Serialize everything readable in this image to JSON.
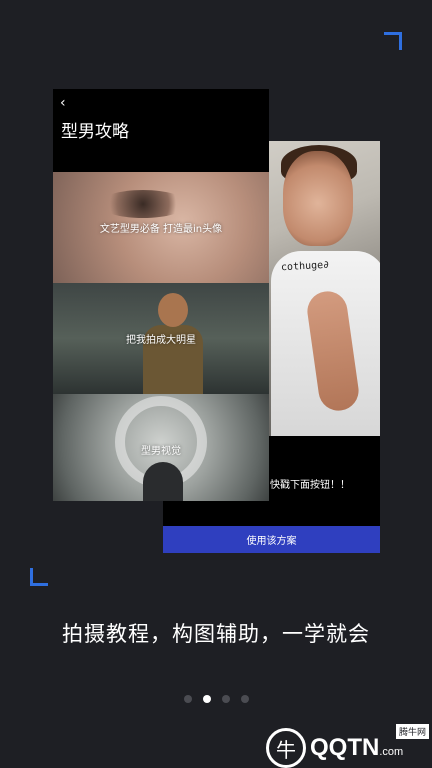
{
  "front_card": {
    "back_glyph": "‹",
    "title": "型男攻略",
    "panels": [
      {
        "label": "文艺型男必备 打造最in头像"
      },
      {
        "label": "把我拍成大明星"
      },
      {
        "label": "型男视觉"
      }
    ]
  },
  "back_card": {
    "shirt_print": "cothuge∂",
    "caption": "快戳下面按钮！！",
    "button_label": "使用该方案"
  },
  "tagline": "拍摄教程，构图辅助，一学就会",
  "pager": {
    "count": 4,
    "active_index": 1
  },
  "watermark": {
    "logo_glyph": "牛",
    "text": "QQTN",
    "suffix": ".com",
    "badge": "腾牛网"
  },
  "colors": {
    "background": "#1e1f24",
    "accent": "#2f6fe0",
    "button": "#2f3fbf"
  }
}
